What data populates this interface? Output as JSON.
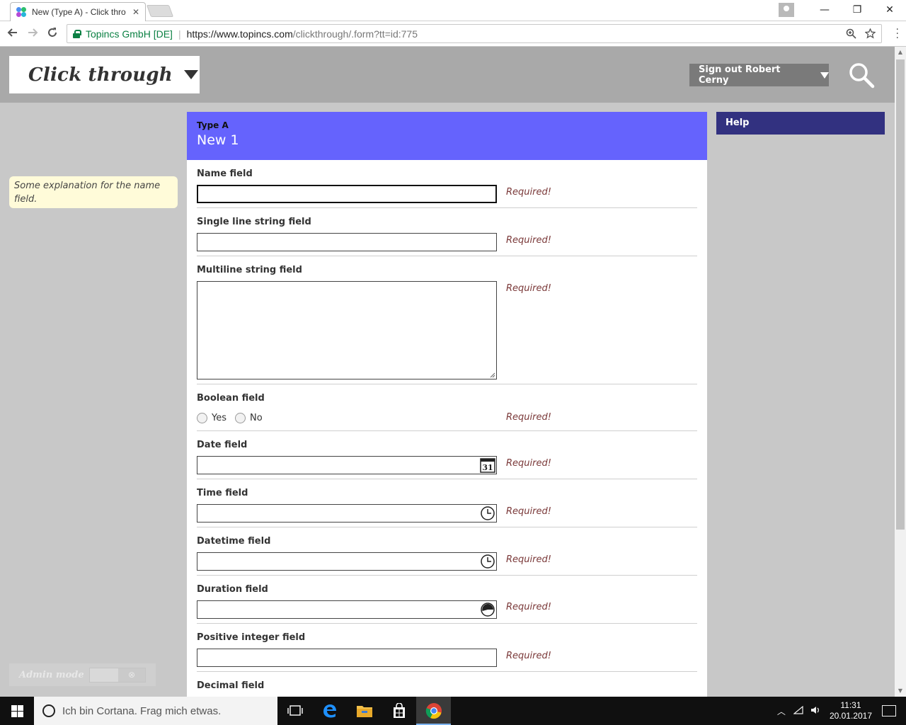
{
  "browser": {
    "tab_title": "New (Type A) - Click thro",
    "tab_close": "✕",
    "window_controls": {
      "minimize": "—",
      "restore": "❐",
      "close": "✕"
    },
    "org_label": "Topincs GmbH [DE]",
    "url_scheme_host": "https://www.topincs.com",
    "url_path": "/clickthrough/.form?tt=id:775"
  },
  "app": {
    "title": "Click through",
    "signout_label": "Sign out Robert Cerny"
  },
  "sidebar": {
    "explanation": "Some explanation for the name field.",
    "admin_mode_label": "Admin mode",
    "admin_toggle_symbol": "⊗"
  },
  "form": {
    "type_label": "Type A",
    "instance_name": "New 1",
    "fields": [
      {
        "label": "Name field",
        "required": "Required!"
      },
      {
        "label": "Single line string field",
        "required": "Required!"
      },
      {
        "label": "Multiline string field",
        "required": "Required!"
      },
      {
        "label": "Boolean field",
        "required": "Required!",
        "options": [
          "Yes",
          "No"
        ]
      },
      {
        "label": "Date field",
        "required": "Required!",
        "icon_text": "31"
      },
      {
        "label": "Time field",
        "required": "Required!"
      },
      {
        "label": "Datetime field",
        "required": "Required!"
      },
      {
        "label": "Duration field",
        "required": "Required!"
      },
      {
        "label": "Positive integer field",
        "required": "Required!"
      },
      {
        "label": "Decimal field",
        "required": ""
      }
    ]
  },
  "help": {
    "label": "Help"
  },
  "taskbar": {
    "cortana_placeholder": "Ich bin Cortana. Frag mich etwas.",
    "time": "11:31",
    "date": "20.01.2017"
  },
  "colors": {
    "form_header": "#6563fd",
    "help_header": "#323180",
    "required_text": "#7a3838",
    "page_background": "#c8c8c8"
  }
}
